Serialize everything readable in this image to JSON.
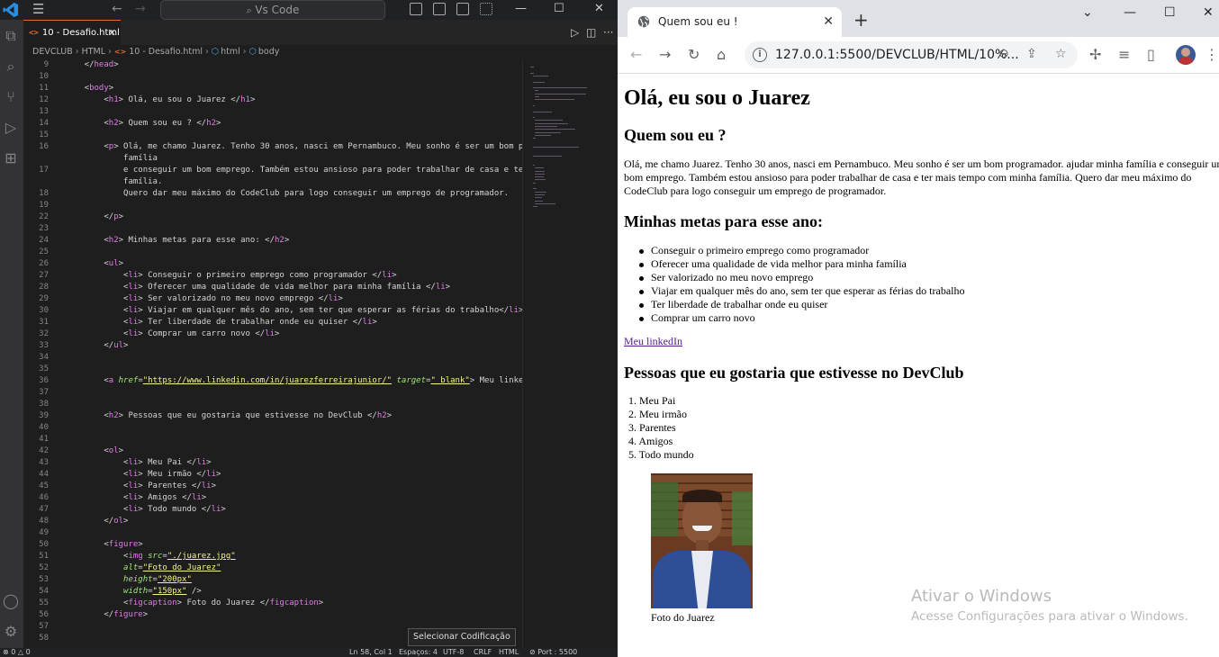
{
  "vscode": {
    "command_center": "Vs Code",
    "tab_label": "10 - Desafio.html",
    "tab_icon": "<>",
    "breadcrumb": [
      "DEVCLUB",
      "HTML",
      "10 - Desafio.html",
      "html",
      "body"
    ],
    "tooltip": "Selecionar Codificação",
    "status_items": [
      "⊗ 0 △ 0",
      "Ln 58, Col 1",
      "Espaços: 4",
      "UTF-8",
      "CRLF",
      "HTML",
      "⊘ Port : 5500"
    ],
    "code_lines": [
      {
        "n": "9",
        "segs": [
          [
            "t",
            "    </"
          ],
          [
            "g",
            "head"
          ],
          [
            "t",
            ">"
          ]
        ]
      },
      {
        "n": "10",
        "segs": []
      },
      {
        "n": "11",
        "segs": [
          [
            "t",
            "    <"
          ],
          [
            "g",
            "body"
          ],
          [
            "t",
            ">"
          ]
        ]
      },
      {
        "n": "12",
        "segs": [
          [
            "t",
            "        <"
          ],
          [
            "g",
            "h1"
          ],
          [
            "t",
            "> Olá, eu sou o Juarez </"
          ],
          [
            "g",
            "h1"
          ],
          [
            "t",
            ">"
          ]
        ]
      },
      {
        "n": "13",
        "segs": []
      },
      {
        "n": "14",
        "segs": [
          [
            "t",
            "        <"
          ],
          [
            "g",
            "h2"
          ],
          [
            "t",
            "> Quem sou eu ? </"
          ],
          [
            "g",
            "h2"
          ],
          [
            "t",
            ">"
          ]
        ]
      },
      {
        "n": "15",
        "segs": []
      },
      {
        "n": "16",
        "segs": [
          [
            "t",
            "        <"
          ],
          [
            "g",
            "p"
          ],
          [
            "t",
            "> Olá, me chamo Juarez. Tenho 30 anos, nasci em Pernambuco. Meu sonho é ser um bom programador. ajudar minha"
          ]
        ]
      },
      {
        "n": "",
        "segs": [
          [
            "t",
            "            família"
          ]
        ]
      },
      {
        "n": "17",
        "segs": [
          [
            "t",
            "            e conseguir um bom emprego. Também estou ansioso para poder trabalhar de casa e ter mais tempo com minha"
          ]
        ]
      },
      {
        "n": "",
        "segs": [
          [
            "t",
            "            família."
          ]
        ]
      },
      {
        "n": "18",
        "segs": [
          [
            "t",
            "            Quero dar meu máximo do CodeClub para logo conseguir um emprego de programador."
          ]
        ]
      },
      {
        "n": "19",
        "segs": []
      },
      {
        "n": "22",
        "segs": [
          [
            "t",
            "        </"
          ],
          [
            "g",
            "p"
          ],
          [
            "t",
            ">"
          ]
        ]
      },
      {
        "n": "23",
        "segs": []
      },
      {
        "n": "24",
        "segs": [
          [
            "t",
            "        <"
          ],
          [
            "g",
            "h2"
          ],
          [
            "t",
            "> Minhas metas para esse ano: </"
          ],
          [
            "g",
            "h2"
          ],
          [
            "t",
            ">"
          ]
        ]
      },
      {
        "n": "25",
        "segs": []
      },
      {
        "n": "26",
        "segs": [
          [
            "t",
            "        <"
          ],
          [
            "g",
            "ul"
          ],
          [
            "t",
            ">"
          ]
        ]
      },
      {
        "n": "27",
        "segs": [
          [
            "t",
            "            <"
          ],
          [
            "g",
            "li"
          ],
          [
            "t",
            "> Conseguir o primeiro emprego como programador </"
          ],
          [
            "g",
            "li"
          ],
          [
            "t",
            ">"
          ]
        ]
      },
      {
        "n": "28",
        "segs": [
          [
            "t",
            "            <"
          ],
          [
            "g",
            "li"
          ],
          [
            "t",
            "> Oferecer uma qualidade de vida melhor para minha família </"
          ],
          [
            "g",
            "li"
          ],
          [
            "t",
            ">"
          ]
        ]
      },
      {
        "n": "29",
        "segs": [
          [
            "t",
            "            <"
          ],
          [
            "g",
            "li"
          ],
          [
            "t",
            "> Ser valorizado no meu novo emprego </"
          ],
          [
            "g",
            "li"
          ],
          [
            "t",
            ">"
          ]
        ]
      },
      {
        "n": "30",
        "segs": [
          [
            "t",
            "            <"
          ],
          [
            "g",
            "li"
          ],
          [
            "t",
            "> Viajar em qualquer mês do ano, sem ter que esperar as férias do trabalho</"
          ],
          [
            "g",
            "li"
          ],
          [
            "t",
            ">"
          ]
        ]
      },
      {
        "n": "31",
        "segs": [
          [
            "t",
            "            <"
          ],
          [
            "g",
            "li"
          ],
          [
            "t",
            "> Ter liberdade de trabalhar onde eu quiser </"
          ],
          [
            "g",
            "li"
          ],
          [
            "t",
            ">"
          ]
        ]
      },
      {
        "n": "32",
        "segs": [
          [
            "t",
            "            <"
          ],
          [
            "g",
            "li"
          ],
          [
            "t",
            "> Comprar um carro novo </"
          ],
          [
            "g",
            "li"
          ],
          [
            "t",
            ">"
          ]
        ]
      },
      {
        "n": "33",
        "segs": [
          [
            "t",
            "        </"
          ],
          [
            "g",
            "ul"
          ],
          [
            "t",
            ">"
          ]
        ]
      },
      {
        "n": "34",
        "segs": []
      },
      {
        "n": "35",
        "segs": []
      },
      {
        "n": "36",
        "segs": [
          [
            "t",
            "        <"
          ],
          [
            "g",
            "a"
          ],
          [
            "t",
            " "
          ],
          [
            "a",
            "href"
          ],
          [
            "t",
            "="
          ],
          [
            "s",
            "\"https://www.linkedin.com/in/juarezferreirajunior/\""
          ],
          [
            "t",
            " "
          ],
          [
            "a",
            "target"
          ],
          [
            "t",
            "="
          ],
          [
            "s",
            "\"_blank\""
          ],
          [
            "t",
            "> Meu linkedIn </"
          ],
          [
            "g",
            "a"
          ],
          [
            "t",
            ">"
          ]
        ]
      },
      {
        "n": "37",
        "segs": []
      },
      {
        "n": "38",
        "segs": []
      },
      {
        "n": "39",
        "segs": [
          [
            "t",
            "        <"
          ],
          [
            "g",
            "h2"
          ],
          [
            "t",
            "> Pessoas que eu gostaria que estivesse no DevClub </"
          ],
          [
            "g",
            "h2"
          ],
          [
            "t",
            ">"
          ]
        ]
      },
      {
        "n": "40",
        "segs": []
      },
      {
        "n": "41",
        "segs": []
      },
      {
        "n": "42",
        "segs": [
          [
            "t",
            "        <"
          ],
          [
            "g",
            "ol"
          ],
          [
            "t",
            ">"
          ]
        ]
      },
      {
        "n": "43",
        "segs": [
          [
            "t",
            "            <"
          ],
          [
            "g",
            "li"
          ],
          [
            "t",
            "> Meu Pai </"
          ],
          [
            "g",
            "li"
          ],
          [
            "t",
            ">"
          ]
        ]
      },
      {
        "n": "44",
        "segs": [
          [
            "t",
            "            <"
          ],
          [
            "g",
            "li"
          ],
          [
            "t",
            "> Meu irmão </"
          ],
          [
            "g",
            "li"
          ],
          [
            "t",
            ">"
          ]
        ]
      },
      {
        "n": "45",
        "segs": [
          [
            "t",
            "            <"
          ],
          [
            "g",
            "li"
          ],
          [
            "t",
            "> Parentes </"
          ],
          [
            "g",
            "li"
          ],
          [
            "t",
            ">"
          ]
        ]
      },
      {
        "n": "46",
        "segs": [
          [
            "t",
            "            <"
          ],
          [
            "g",
            "li"
          ],
          [
            "t",
            "> Amigos </"
          ],
          [
            "g",
            "li"
          ],
          [
            "t",
            ">"
          ]
        ]
      },
      {
        "n": "47",
        "segs": [
          [
            "t",
            "            <"
          ],
          [
            "g",
            "li"
          ],
          [
            "t",
            "> Todo mundo </"
          ],
          [
            "g",
            "li"
          ],
          [
            "t",
            ">"
          ]
        ]
      },
      {
        "n": "48",
        "segs": [
          [
            "t",
            "        </"
          ],
          [
            "g",
            "ol"
          ],
          [
            "t",
            ">"
          ]
        ]
      },
      {
        "n": "49",
        "segs": []
      },
      {
        "n": "50",
        "segs": [
          [
            "t",
            "        <"
          ],
          [
            "g",
            "figure"
          ],
          [
            "t",
            ">"
          ]
        ]
      },
      {
        "n": "51",
        "segs": [
          [
            "t",
            "            <"
          ],
          [
            "g",
            "img"
          ],
          [
            "t",
            " "
          ],
          [
            "a",
            "src"
          ],
          [
            "t",
            "="
          ],
          [
            "s",
            "\"./juarez.jpg\""
          ]
        ]
      },
      {
        "n": "52",
        "segs": [
          [
            "t",
            "            "
          ],
          [
            "a",
            "alt"
          ],
          [
            "t",
            "="
          ],
          [
            "s",
            "\"Foto do Juarez\""
          ]
        ]
      },
      {
        "n": "53",
        "segs": [
          [
            "t",
            "            "
          ],
          [
            "a",
            "height"
          ],
          [
            "t",
            "="
          ],
          [
            "s",
            "\"200px\""
          ]
        ]
      },
      {
        "n": "54",
        "segs": [
          [
            "t",
            "            "
          ],
          [
            "a",
            "width"
          ],
          [
            "t",
            "="
          ],
          [
            "s",
            "\"150px\""
          ],
          [
            "t",
            " />"
          ]
        ]
      },
      {
        "n": "55",
        "segs": [
          [
            "t",
            "            <"
          ],
          [
            "g",
            "figcaption"
          ],
          [
            "t",
            "> Foto do Juarez </"
          ],
          [
            "g",
            "figcaption"
          ],
          [
            "t",
            ">"
          ]
        ]
      },
      {
        "n": "56",
        "segs": [
          [
            "t",
            "        </"
          ],
          [
            "g",
            "figure"
          ],
          [
            "t",
            ">"
          ]
        ]
      },
      {
        "n": "57",
        "segs": []
      },
      {
        "n": "58",
        "segs": []
      }
    ]
  },
  "chrome": {
    "tab_title": "Quem sou eu !",
    "url": "127.0.0.1:5500/DEVCLUB/HTML/10%...",
    "page": {
      "h1": "Olá, eu sou o Juarez",
      "h2_about": "Quem sou eu ?",
      "paragraph": "Olá, me chamo Juarez. Tenho 30 anos, nasci em Pernambuco. Meu sonho é ser um bom programador. ajudar minha família e conseguir um bom emprego. Também estou ansioso para poder trabalhar de casa e ter mais tempo com minha família. Quero dar meu máximo do CodeClub para logo conseguir um emprego de programador.",
      "h2_goals": "Minhas metas para esse ano:",
      "goals": [
        "Conseguir o primeiro emprego como programador",
        "Oferecer uma qualidade de vida melhor para minha família",
        "Ser valorizado no meu novo emprego",
        "Viajar em qualquer mês do ano, sem ter que esperar as férias do trabalho",
        "Ter liberdade de trabalhar onde eu quiser",
        "Comprar um carro novo"
      ],
      "link_text": "Meu linkedIn",
      "h2_people": "Pessoas que eu gostaria que estivesse no DevClub",
      "people": [
        "1. Meu Pai",
        "2. Meu irmão",
        "3. Parentes",
        "4. Amigos",
        "5. Todo mundo"
      ],
      "figcaption": "Foto do Juarez"
    },
    "watermark_title": "Ativar o Windows",
    "watermark_sub": "Acesse Configurações para ativar o Windows."
  }
}
